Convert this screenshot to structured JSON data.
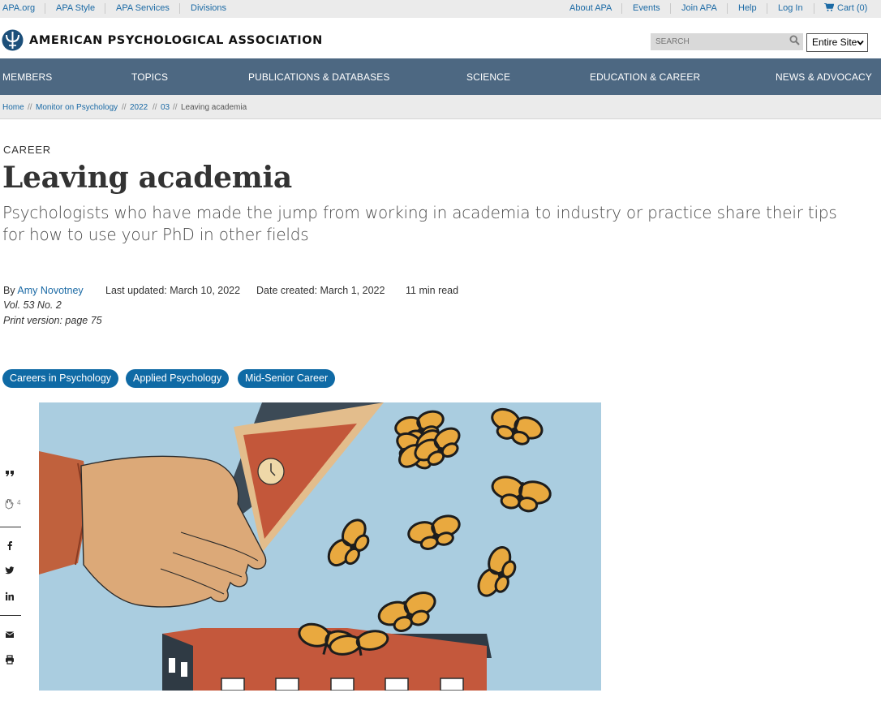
{
  "utility": {
    "left_links": [
      "APA.org",
      "APA Style",
      "APA Services",
      "Divisions"
    ],
    "right_links": [
      "About APA",
      "Events",
      "Join APA",
      "Help",
      "Log In"
    ],
    "cart_label": "Cart (0)"
  },
  "header": {
    "logo_text": "AMERICAN PSYCHOLOGICAL ASSOCIATION",
    "search_placeholder": "SEARCH",
    "scope_selected": "Entire Site"
  },
  "nav": {
    "items": [
      "MEMBERS",
      "TOPICS",
      "PUBLICATIONS & DATABASES",
      "SCIENCE",
      "EDUCATION & CAREER",
      "NEWS & ADVOCACY"
    ]
  },
  "breadcrumb": {
    "items": [
      "Home",
      "Monitor on Psychology",
      "2022",
      "03"
    ],
    "separator": "//",
    "current": "Leaving academia"
  },
  "article": {
    "kicker": "CAREER",
    "title": "Leaving academia",
    "subtitle": "Psychologists who have made the jump from working in academia to industry or practice share their tips for how to use your PhD in other fields",
    "byline_prefix": "By",
    "author": "Amy Novotney",
    "last_updated": "Last updated: March 10, 2022",
    "date_created": "Date created: March 1, 2022",
    "read_time": "11 min read",
    "volume": "Vol. 53 No. 2",
    "print_version": "Print version: page 75",
    "tags": [
      "Careers in Psychology",
      "Applied Psychology",
      "Mid-Senior Career"
    ]
  },
  "share": {
    "clap_count": "4",
    "icons": [
      "quote-icon",
      "clap-icon",
      "facebook-icon",
      "twitter-icon",
      "linkedin-icon",
      "email-icon",
      "print-icon"
    ]
  },
  "colors": {
    "nav_bg": "#4d6882",
    "link": "#1b6aa5",
    "tag_bg": "#0f6aa5",
    "utility_bg": "#ebebeb"
  }
}
